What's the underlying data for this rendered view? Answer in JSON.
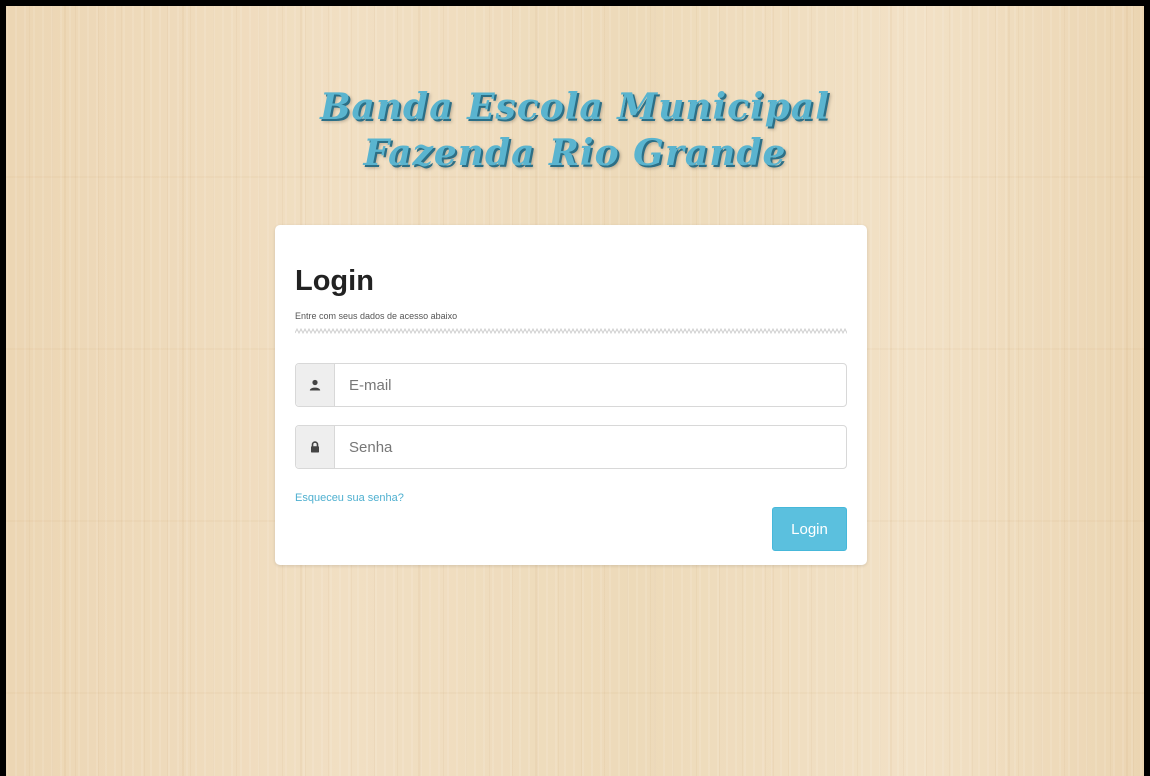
{
  "header": {
    "title_line1": "Banda Escola Municipal",
    "title_line2": "Fazenda Rio Grande"
  },
  "login": {
    "heading": "Login",
    "subtitle": "Entre com seus dados de acesso abaixo",
    "email_placeholder": "E-mail",
    "email_icon": "user-icon",
    "password_placeholder": "Senha",
    "password_icon": "lock-icon",
    "forgot_link": "Esqueceu sua senha?",
    "submit_label": "Login"
  },
  "colors": {
    "accent": "#5bc0de",
    "title": "#5ab4cf",
    "background": "#efdcbd"
  }
}
